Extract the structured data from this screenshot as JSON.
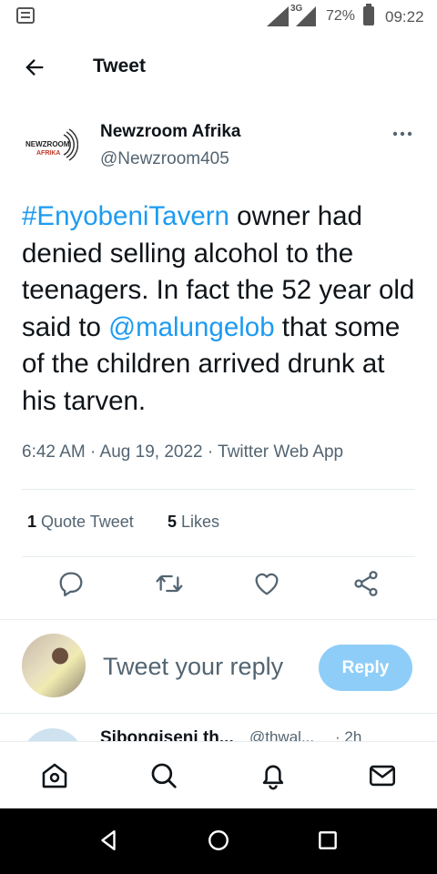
{
  "status_bar": {
    "network": "3G",
    "battery_percent": "72%",
    "time": "09:22"
  },
  "header": {
    "title": "Tweet"
  },
  "tweet": {
    "author_name": "Newzroom Afrika",
    "author_handle": "@Newzroom405",
    "logo_text_top": "NEWZROOM",
    "logo_text_bottom": "AFRIKA",
    "text_parts": {
      "hashtag": "#EnyobeniTavern",
      "part1": " owner had denied selling alcohol to the teenagers. In fact the 52 year old said to ",
      "mention": "@malungelob",
      "part2": " that some of the children arrived drunk at his tarven."
    },
    "meta": "6:42 AM · Aug 19, 2022 · Twitter Web App",
    "stats": {
      "quote_count": "1",
      "quote_label": " Quote Tweet",
      "like_count": "5",
      "like_label": " Likes"
    }
  },
  "reply_composer": {
    "placeholder": "Tweet your reply",
    "button_label": "Reply"
  },
  "next_reply": {
    "name": "Sibongiseni th...",
    "handle": "@thwal...",
    "time": "· 2h"
  },
  "colors": {
    "accent": "#1d9bf0",
    "reply_button": "#8ecdf8",
    "secondary_text": "#536471"
  }
}
